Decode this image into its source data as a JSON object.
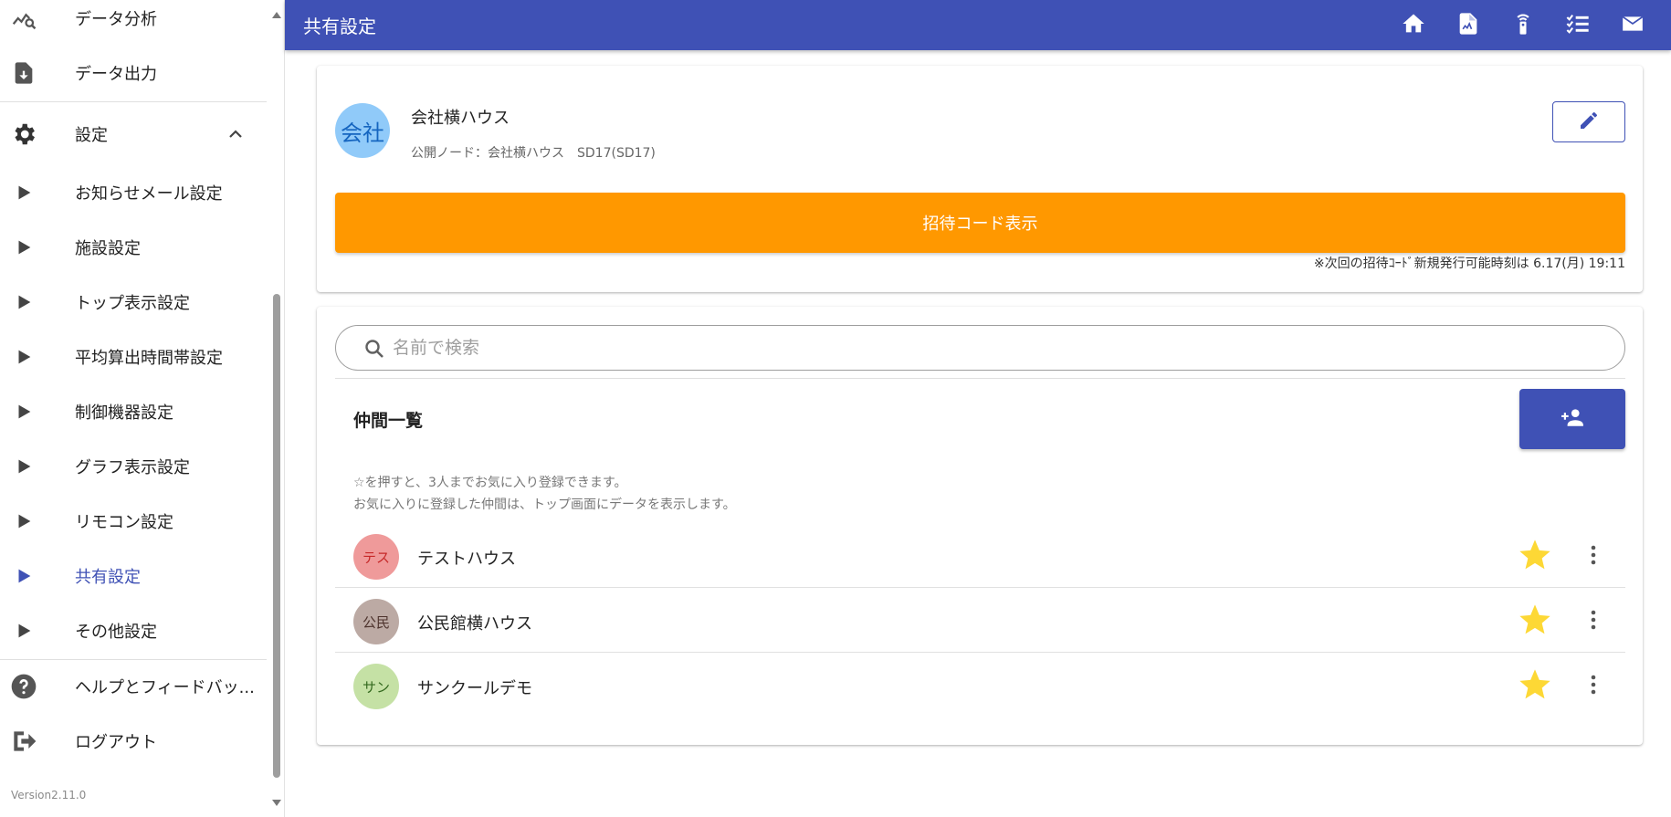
{
  "sidebar": {
    "top_items": [
      {
        "label": "データ分析",
        "icon": "data-analysis-icon"
      },
      {
        "label": "データ出力",
        "icon": "data-export-icon"
      }
    ],
    "settings": {
      "label": "設定",
      "icon": "gear-icon",
      "expanded": true
    },
    "sub_items": [
      {
        "label": "お知らせメール設定"
      },
      {
        "label": "施設設定"
      },
      {
        "label": "トップ表示設定"
      },
      {
        "label": "平均算出時間帯設定"
      },
      {
        "label": "制御機器設定"
      },
      {
        "label": "グラフ表示設定"
      },
      {
        "label": "リモコン設定"
      },
      {
        "label": "共有設定",
        "active": true
      },
      {
        "label": "その他設定"
      }
    ],
    "help": {
      "label": "ヘルプとフィードバッ...",
      "icon": "help-icon"
    },
    "logout": {
      "label": "ログアウト",
      "icon": "logout-icon"
    },
    "version": "Version2.11.0"
  },
  "header": {
    "title": "共有設定",
    "actions": [
      "home-icon",
      "document-icon",
      "remote-icon",
      "checklist-icon",
      "mail-icon"
    ]
  },
  "company": {
    "avatar_text": "会社",
    "name": "会社横ハウス",
    "node": "公開ノード：会社横ハウス　SD17(SD17)",
    "invite_button": "招待コード表示",
    "invite_note": "※次回の招待ｺｰﾄﾞ新規発行可能時刻は 6.17(月) 19:11"
  },
  "members": {
    "search_placeholder": "名前で検索",
    "title": "仲間一覧",
    "hint_line1": "☆を押すと、3人までお気に入り登録できます。",
    "hint_line2": "お気に入りに登録した仲間は、トップ画面にデータを表示します。",
    "list": [
      {
        "avatar_text": "テス",
        "name": "テストハウス",
        "favorite": true
      },
      {
        "avatar_text": "公民",
        "name": "公民館横ハウス",
        "favorite": true
      },
      {
        "avatar_text": "サン",
        "name": "サンクールデモ",
        "favorite": true
      }
    ]
  },
  "colors": {
    "primary": "#3f51b5",
    "accent": "#ff9800",
    "star": "#fdd835",
    "avatar_test": "#ef9a9a",
    "avatar_kominkan": "#bcaaa4",
    "avatar_sun": "#c5e1a5"
  }
}
